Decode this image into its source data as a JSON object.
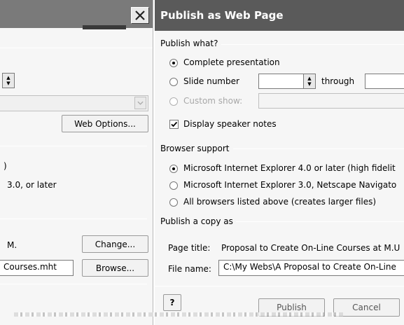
{
  "left_dialog": {
    "web_options_button": "Web Options...",
    "browser_option_1_fragment": ")",
    "browser_option_2_fragment": "3.0, or later",
    "publish_title_fragment": "M.",
    "change_button": "Change...",
    "file_name_fragment": "Courses.mht",
    "browse_button": "Browse..."
  },
  "dialog": {
    "title": "Publish as Web Page",
    "publish_what": {
      "label": "Publish what?",
      "complete_presentation": "Complete presentation",
      "slide_number": "Slide number",
      "slide_from": "",
      "through": "through",
      "slide_to": "",
      "custom_show": "Custom show:",
      "display_speaker_notes": "Display speaker notes",
      "selected": "complete_presentation",
      "speaker_notes_checked": true
    },
    "browser_support": {
      "label": "Browser support",
      "options": [
        "Microsoft Internet Explorer 4.0 or later (high fidelit",
        "Microsoft Internet Explorer 3.0, Netscape Navigato",
        "All browsers listed above (creates larger files)"
      ],
      "selected_index": 0
    },
    "publish_copy": {
      "label": "Publish a copy as",
      "page_title_label": "Page title:",
      "page_title_value": "Proposal to Create On-Line Courses at M.U",
      "file_name_label": "File name:",
      "file_name_value": "C:\\My Webs\\A Proposal to Create On-Line"
    },
    "publish_button": "Publish",
    "cancel_button": "Cancel"
  },
  "icons": {
    "close": "close-icon",
    "spin": "spin-arrows-icon",
    "dropdown": "chevron-down-icon",
    "help": "help-icon"
  },
  "colors": {
    "titlebar": "#5a5a5a",
    "dialog_bg": "#f6f6f6"
  }
}
